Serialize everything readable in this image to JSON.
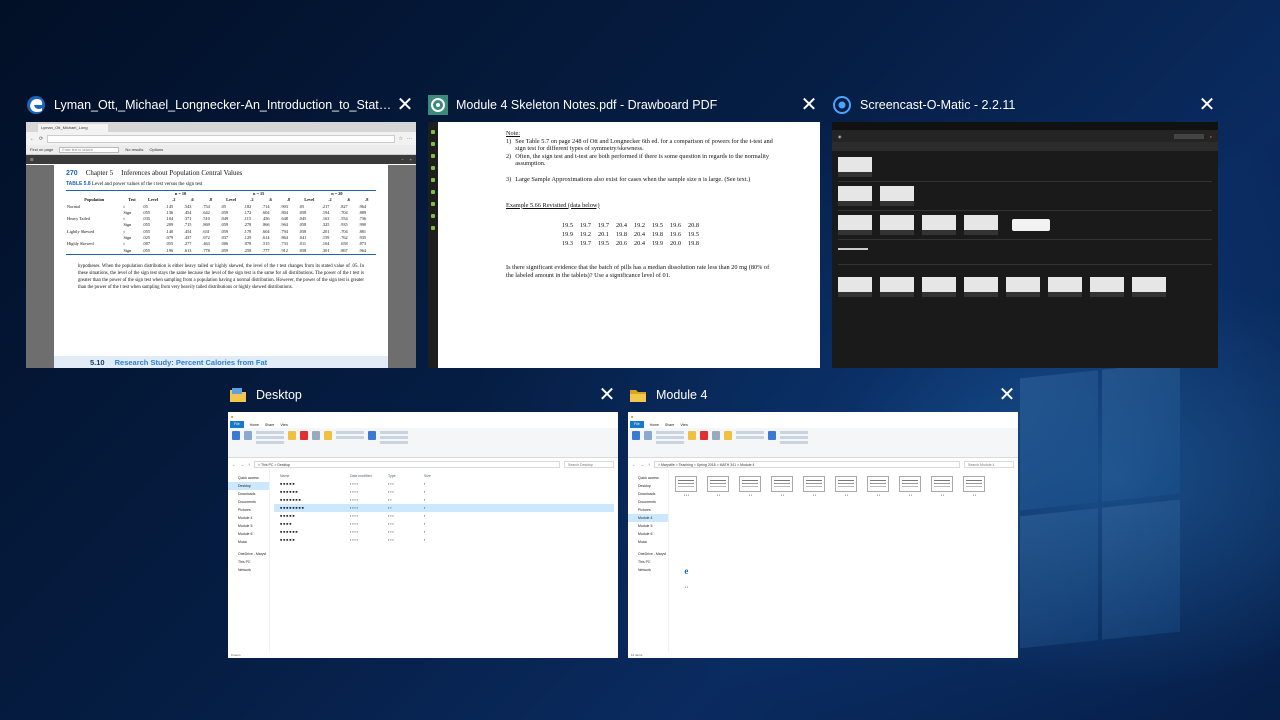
{
  "windows": [
    {
      "title": "Lyman_Ott,_Michael_Longnecker-An_Introduction_to_Statistical_Me...",
      "icon": "edge-icon",
      "content": {
        "tab_label": "Lyman_Ott_Michael_Long",
        "find_label": "Find on page",
        "find_placeholder": "Enter text to search",
        "no_results": "No results",
        "options": "Options",
        "page_number": "270",
        "chapter": "Chapter 5",
        "chapter_title": "Inferences about Population Central Values",
        "table_label": "TABLE 5.8",
        "table_caption": "Level and power values of the t test versus the sign test",
        "section_number": "5.10",
        "section_title": "Research Study: Percent Calories from Fat"
      }
    },
    {
      "title": "Module 4 Skeleton Notes.pdf - Drawboard PDF",
      "icon": "drawboard-icon",
      "content": {
        "note_heading": "Note:",
        "notes": [
          {
            "num": "1)",
            "text": "See Table 5.7 on page 248 of Ott and Longnecker 6th ed. for a comparison of powers for the t-test and sign test for different types of symmetry/skewness."
          },
          {
            "num": "2)",
            "text": "Often, the sign test and t-test are both performed if there is some question in regards to the normality assumption."
          },
          {
            "num": "3)",
            "text": "Large Sample Approximations also exist for cases when the sample size n is large. (See text.)"
          }
        ],
        "example_title": "Example 5.66 Revisited (data below)",
        "data_rows": [
          [
            "19.5",
            "19.7",
            "19.7",
            "20.4",
            "19.2",
            "19.5",
            "19.6",
            "20.8"
          ],
          [
            "19.9",
            "19.2",
            "20.1",
            "19.8",
            "20.4",
            "19.8",
            "19.6",
            "19.5"
          ],
          [
            "19.3",
            "19.7",
            "19.5",
            "20.6",
            "20.4",
            "19.9",
            "20.0",
            "19.8"
          ]
        ],
        "question": "Is there significant evidence that the batch of pills has a median dissolution rate less than 20 mg (80% of the labeled amount in the tablets)? Use a significance level of 01."
      }
    },
    {
      "title": "Screencast-O-Matic - 2.2.11",
      "icon": "screencast-icon"
    },
    {
      "title": "Desktop",
      "icon": "folder-icon",
      "content": {
        "path": "> This PC > Desktop",
        "search_placeholder": "Search Desktop",
        "columns": [
          "Name",
          "Date modified",
          "Type",
          "Size"
        ],
        "nav": [
          "Quick access",
          "Desktop",
          "Downloads",
          "Documents",
          "Pictures",
          "Module 4",
          "Module 5",
          "Module 6",
          "Music",
          "OneDrive - Maryvi",
          "This PC",
          "Network"
        ],
        "status": "9 items"
      }
    },
    {
      "title": "Module 4",
      "icon": "folder-icon",
      "content": {
        "path": "> Maryville > Teaching > Spring 2018 > MATH 341 > Module 4",
        "search_placeholder": "Search Module 4",
        "status": "12 items"
      }
    }
  ],
  "colors": {
    "close": "#ffffff",
    "edge_blue": "#1b64b8",
    "drawboard_teal": "#3b8a7a",
    "folder_yellow": "#f3c74d"
  }
}
